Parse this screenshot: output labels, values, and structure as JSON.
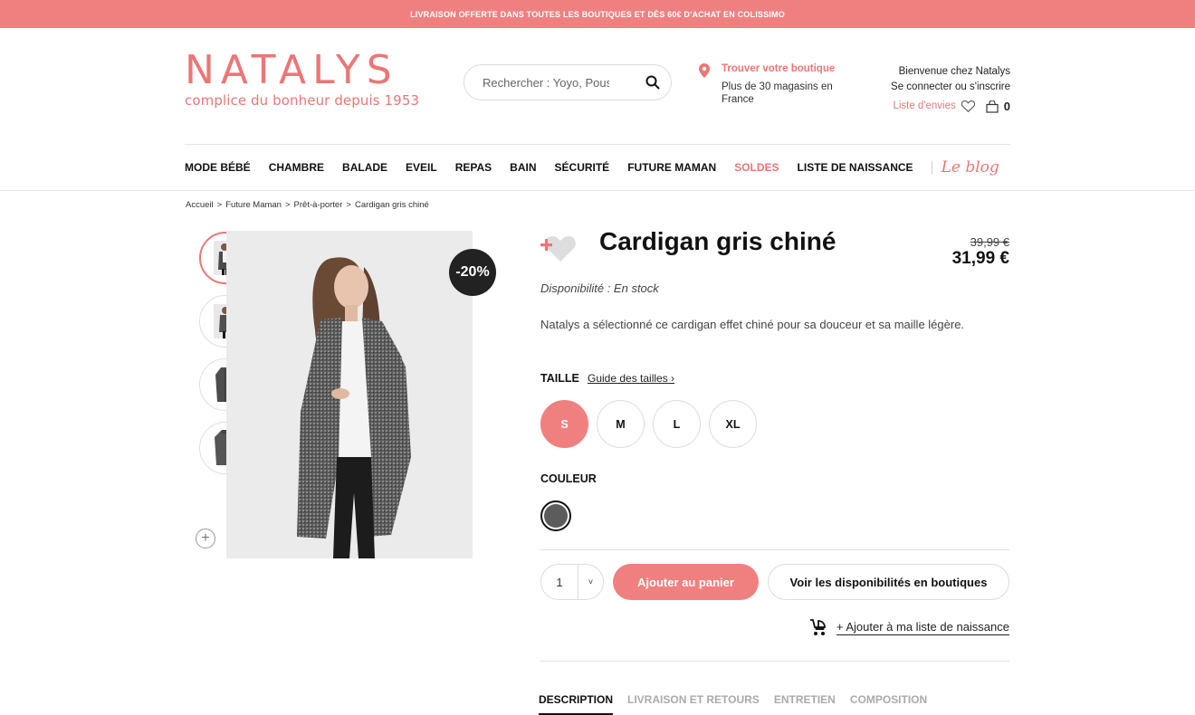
{
  "promo": {
    "text": "LIVRAISON OFFERTE DANS TOUTES LES BOUTIQUES ET DÈS 60€ D'ACHAT EN COLISSIMO"
  },
  "logo": {
    "word": "NATALYS",
    "tagline": "complice du bonheur depuis 1953"
  },
  "search": {
    "placeholder": "Rechercher : Yoyo, Poussette..."
  },
  "store": {
    "title": "Trouver votre boutique",
    "subtitle": "Plus de 30 magasins en France"
  },
  "account": {
    "welcome": "Bienvenue chez Natalys",
    "login": "Se connecter ou s'inscrire",
    "wishlist": "Liste d'envies",
    "cart_count": "0"
  },
  "nav": {
    "items": [
      "MODE BÉBÉ",
      "CHAMBRE",
      "BALADE",
      "EVEIL",
      "REPAS",
      "BAIN",
      "SÉCURITÉ",
      "FUTURE MAMAN",
      "SOLDES",
      "LISTE DE NAISSANCE"
    ],
    "blog": "Le blog"
  },
  "breadcrumb": [
    "Accueil",
    ">",
    "Future Maman",
    ">",
    "Prêt-à-porter",
    ">",
    "Cardigan gris chiné"
  ],
  "product": {
    "badge": "-20%",
    "title": "Cardigan gris chiné",
    "price_old": "39,99 €",
    "price_new": "31,99 €",
    "availability": "Disponibilité : En stock",
    "description": "Natalys a sélectionné ce cardigan effet chiné pour sa douceur et sa maille légère.",
    "size_label": "TAILLE",
    "size_guide": "Guide des tailles ›",
    "sizes": [
      "S",
      "M",
      "L",
      "XL"
    ],
    "color_label": "COULEUR",
    "swatch_color": "#5c5c5c",
    "quantity": "1",
    "qty_arrow": "˅",
    "add_to_cart": "Ajouter au panier",
    "store_availability": "Voir les disponibilités en boutiques",
    "birth_list": "+ Ajouter à ma liste de naissance"
  },
  "tabs": [
    "DESCRIPTION",
    "LIVRAISON ET RETOURS",
    "ENTRETIEN",
    "COMPOSITION"
  ],
  "colors": {
    "brand": "#ec7676",
    "promo_bg": "#f08080",
    "badge_bg": "#222222"
  }
}
